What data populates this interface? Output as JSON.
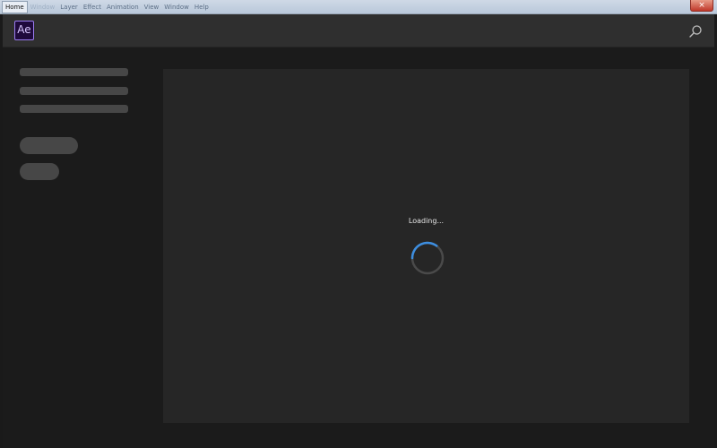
{
  "window": {
    "menu": [
      "Home",
      "Window",
      "Layer",
      "Effect",
      "Animation",
      "View",
      "Window",
      "Help"
    ],
    "close_glyph": "×"
  },
  "header": {
    "logo_text": "Ae",
    "logo_color": "#9a7cf0",
    "search_icon": "search-icon"
  },
  "skeleton": {
    "line_count": 3,
    "pill_count": 2
  },
  "content": {
    "loading_label": "Loading...",
    "spinner_color": "#3d8ee0"
  }
}
